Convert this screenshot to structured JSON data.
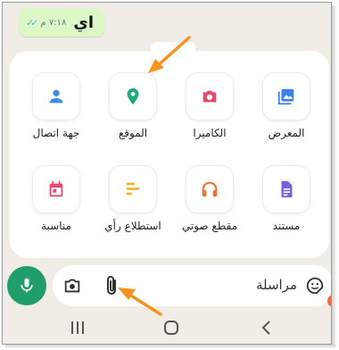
{
  "chat": {
    "message_text": "اي",
    "time": "٧:١٨ م",
    "status_ticks": "✓✓"
  },
  "attachments": [
    {
      "label": "جهة اتصال",
      "icon": "person-icon",
      "color": "#3d8fe0"
    },
    {
      "label": "الموقع",
      "icon": "location-pin-icon",
      "color": "#1faa7d"
    },
    {
      "label": "الكاميرا",
      "icon": "camera-icon",
      "color": "#e8476b"
    },
    {
      "label": "المعرض",
      "icon": "gallery-icon",
      "color": "#3d7fe6"
    },
    {
      "label": "مناسبة",
      "icon": "calendar-icon",
      "color": "#e8476b"
    },
    {
      "label": "استطلاع رأي",
      "icon": "poll-icon",
      "color": "#f2b632"
    },
    {
      "label": "مقطع صوتي",
      "icon": "headphones-icon",
      "color": "#f27232"
    },
    {
      "label": "مستند",
      "icon": "document-icon",
      "color": "#7b5fe0"
    }
  ],
  "input": {
    "placeholder": "مراسلة"
  },
  "colors": {
    "mic": "#1f9e6b",
    "arrow": "#f7941d",
    "background": "#f1ece6"
  }
}
